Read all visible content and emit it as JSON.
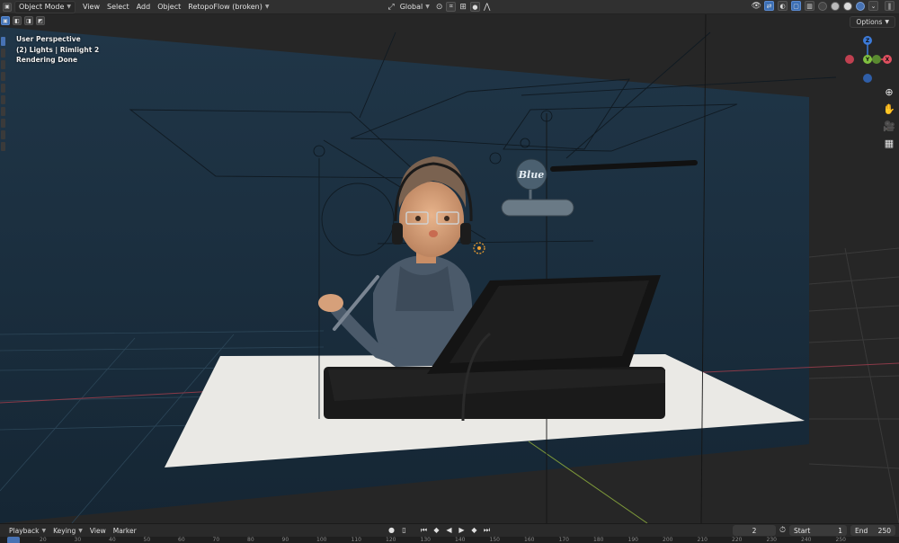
{
  "header": {
    "mode": "Object Mode",
    "menus": [
      "View",
      "Select",
      "Add",
      "Object"
    ],
    "addon": "RetopoFlow (broken)",
    "transform_orientation": "Global"
  },
  "viewport": {
    "info_lines": [
      "User Perspective",
      "(2) Lights | Rimlight 2",
      "Rendering Done"
    ],
    "options_label": "Options",
    "gizmo": {
      "z": "Z",
      "y": "Y",
      "x": "X"
    },
    "mic_label": "Blue",
    "colors": {
      "backdrop": "#1d3040",
      "floor": "#ebebe8",
      "accent": "#4772b3",
      "axis_x": "#e05060",
      "axis_y": "#80c040",
      "axis_z": "#3c7ad8"
    }
  },
  "timeline": {
    "menus": [
      "Playback",
      "Keying",
      "View",
      "Marker"
    ],
    "current_frame": "2",
    "start_label": "Start",
    "start_value": "1",
    "end_label": "End",
    "end_value": "250",
    "ruler_ticks": [
      "20",
      "30",
      "40",
      "50",
      "60",
      "70",
      "80",
      "90",
      "100",
      "110",
      "120",
      "130",
      "140",
      "150",
      "160",
      "170",
      "180",
      "190",
      "200",
      "210",
      "220",
      "230",
      "240",
      "250"
    ]
  }
}
